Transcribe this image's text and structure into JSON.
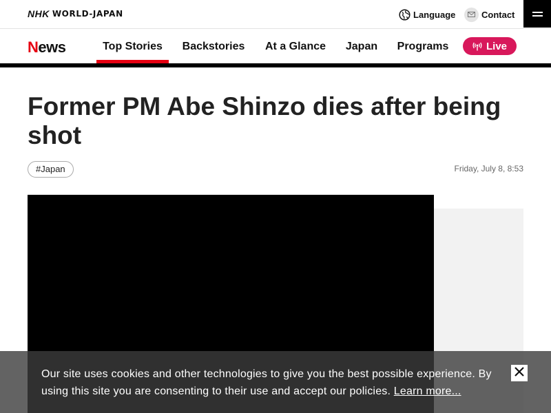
{
  "brand": {
    "nhk": "NHK",
    "world": "WORLD-JAPAN"
  },
  "utility": {
    "language_label": "Language",
    "language_icon": "globe-icon",
    "contact_label": "Contact",
    "contact_icon": "mail-icon",
    "menu_icon": "hamburger-menu-icon"
  },
  "nav": {
    "logo_initial": "N",
    "logo_rest": "ews",
    "items": [
      {
        "label": "Top Stories",
        "active": true
      },
      {
        "label": "Backstories",
        "active": false
      },
      {
        "label": "At a Glance",
        "active": false
      },
      {
        "label": "Japan",
        "active": false
      },
      {
        "label": "Programs",
        "active": false
      }
    ],
    "live_label": "Live",
    "live_icon": "broadcast-icon"
  },
  "article": {
    "headline": "Former PM Abe Shinzo dies after being shot",
    "tag": "#Japan",
    "date": "Friday, July 8, 8:53"
  },
  "cookie": {
    "text": "Our site uses cookies and other technologies to give you the best possible experience. By using this site you are consenting to their use and accept our policies. ",
    "link": "Learn more...",
    "close_icon": "close-icon"
  },
  "colors": {
    "accent_red": "#e60012",
    "live_pink": "#d8185b",
    "banner_bg": "rgba(60,60,60,0.8)"
  }
}
